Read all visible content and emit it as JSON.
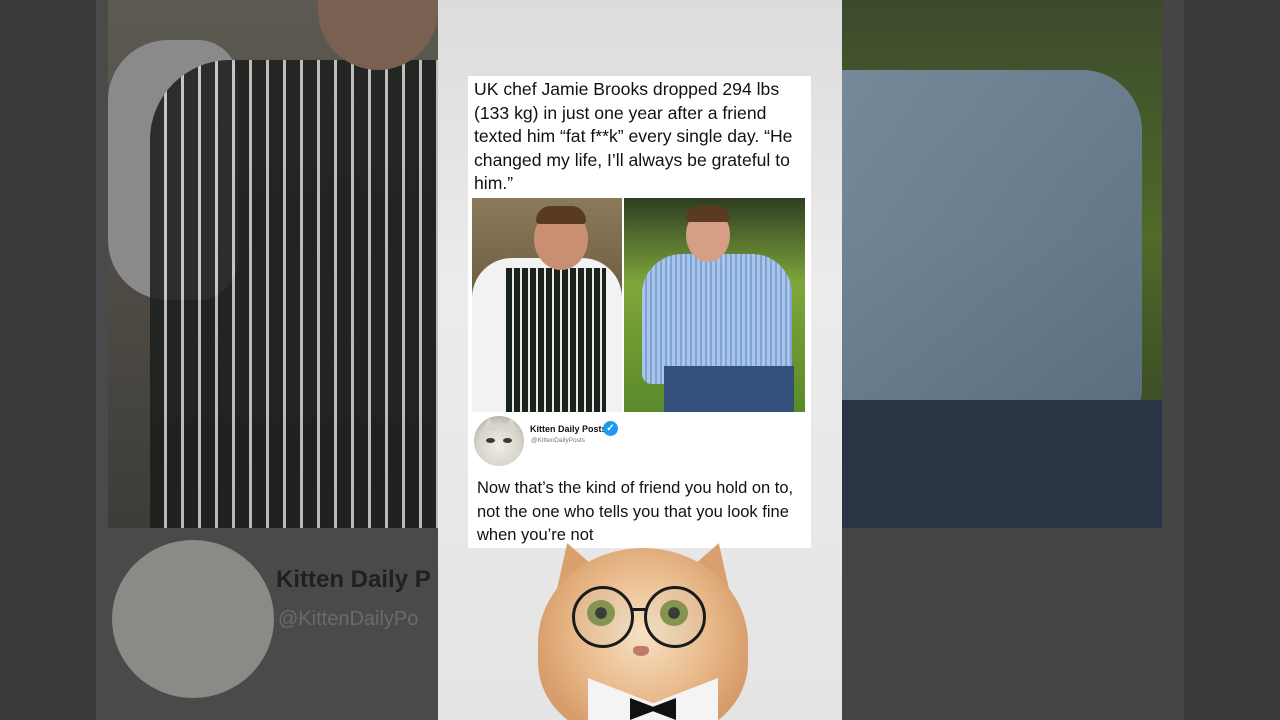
{
  "post": {
    "text": "UK chef Jamie Brooks dropped 294 lbs (133 kg) in just one year after a friend texted him “fat f**k” every single day. “He changed my life, I’ll always be grateful to him.”"
  },
  "author": {
    "name": "Kitten Daily Posts",
    "handle": "@KittenDailyPosts",
    "verified_icon": "✓"
  },
  "reply": {
    "text": "Now that’s the kind of friend you hold on to, not the one who tells you that you look fine when you’re not"
  },
  "background": {
    "name_partial": "Kitten Daily P",
    "handle_partial": "@KittenDailyPo"
  },
  "colors": {
    "verified_badge": "#1d9bf0",
    "card_bg": "#ffffff"
  }
}
